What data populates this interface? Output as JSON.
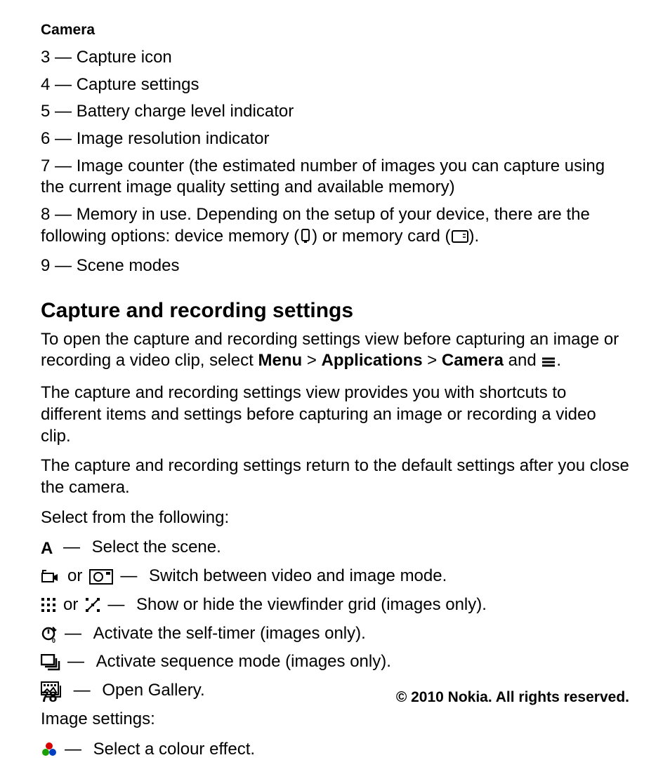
{
  "header": "Camera",
  "legend": {
    "i3": {
      "num": "3",
      "text": "Capture icon"
    },
    "i4": {
      "num": "4",
      "text": "Capture settings"
    },
    "i5": {
      "num": "5",
      "text": "Battery charge level indicator"
    },
    "i6": {
      "num": "6",
      "text": "Image resolution indicator"
    },
    "i7": {
      "num": "7",
      "text": "Image counter (the estimated number of images you can capture using the current image quality setting and available memory)"
    },
    "i8": {
      "num": "8",
      "lead": "Memory in use. Depending on the setup of your device, there are the following options: device memory (",
      "mid": ") or memory card (",
      "tail": ")."
    },
    "i9": {
      "num": "9",
      "text": "Scene modes"
    }
  },
  "section": {
    "heading": "Capture and recording settings",
    "p1": {
      "a": "To open the capture and recording settings view before capturing an image or recording a video clip, select ",
      "menu": "Menu",
      "gt1": " > ",
      "apps": "Applications",
      "gt2": " > ",
      "camera": "Camera",
      "b": " and ",
      "c": "."
    },
    "p2": "The capture and recording settings view provides you with shortcuts to different items and settings before capturing an image or recording a video clip.",
    "p3": "The capture and recording settings return to the default settings after you close the camera.",
    "p4": "Select from the following:"
  },
  "options": {
    "scene": {
      "text": "Select the scene."
    },
    "switch": {
      "or": "or",
      "text": "Switch between video and image mode."
    },
    "grid": {
      "or": "or",
      "text": "Show or hide the viewfinder grid (images only)."
    },
    "timer": {
      "text": "Activate the self-timer (images only)."
    },
    "seq": {
      "text": "Activate sequence mode (images only)."
    },
    "gallery": {
      "text": "Open Gallery."
    },
    "imagesettings": "Image settings:",
    "colour": {
      "text": "Select a colour effect."
    }
  },
  "footer": {
    "page": "78",
    "copyright": "© 2010 Nokia. All rights reserved."
  }
}
